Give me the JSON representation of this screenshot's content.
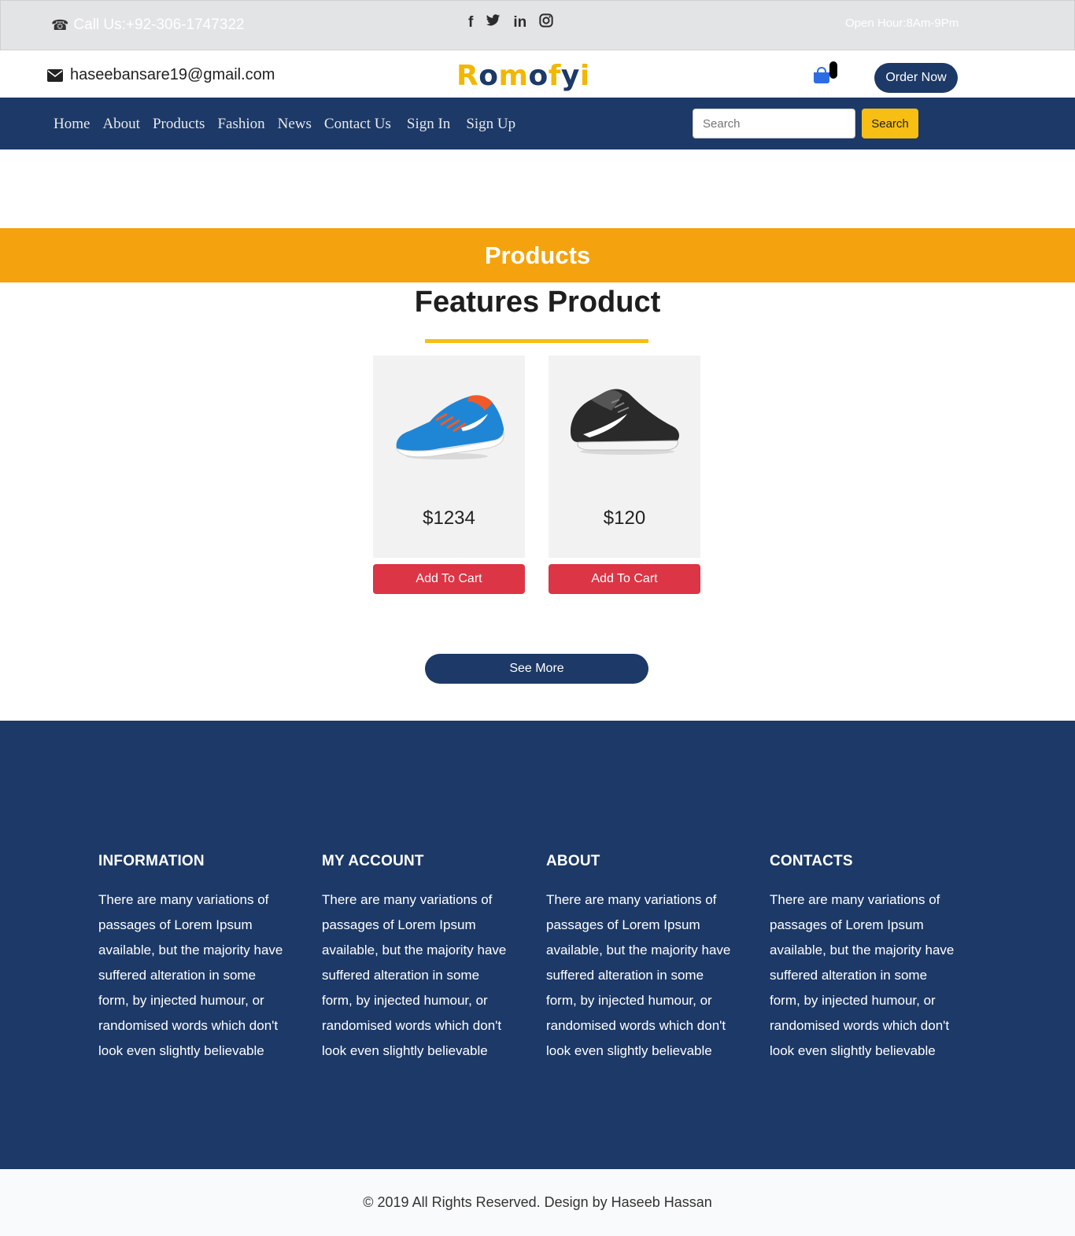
{
  "topbar": {
    "call_text": "Call Us:+92-306-1747322",
    "social_icons": [
      "facebook-icon",
      "twitter-icon",
      "linkedin-icon",
      "instagram-icon"
    ],
    "hours_text": "Open Hour:8Am-9Pm"
  },
  "header": {
    "email": "haseebansare19@gmail.com",
    "logo_parts": [
      "R",
      "o",
      "m",
      "o",
      "f",
      "y",
      "i"
    ],
    "order_label": "Order Now"
  },
  "nav": {
    "links": [
      "Home",
      "About",
      "Products",
      "Fashion",
      "News",
      "Contact Us",
      "Sign In",
      "Sign Up"
    ],
    "search_placeholder": "Search",
    "search_button": "Search"
  },
  "banner": {
    "title": "Products"
  },
  "features": {
    "title": "Features Product",
    "products": [
      {
        "price": "$1234",
        "button": "Add To Cart",
        "color": "#1f86d6"
      },
      {
        "price": "$120",
        "button": "Add To Cart",
        "color": "#2a2a2a"
      }
    ],
    "see_more": "See More"
  },
  "footer": {
    "columns": [
      {
        "title": "INFORMATION",
        "text": "There are many variations of passages of Lorem Ipsum available, but the majority have suffered alteration in some form, by injected humour, or randomised words which don't look even slightly believable"
      },
      {
        "title": "MY ACCOUNT",
        "text": "There are many variations of passages of Lorem Ipsum available, but the majority have suffered alteration in some form, by injected humour, or randomised words which don't look even slightly believable"
      },
      {
        "title": "ABOUT",
        "text": "There are many variations of passages of Lorem Ipsum available, but the majority have suffered alteration in some form, by injected humour, or randomised words which don't look even slightly believable"
      },
      {
        "title": "CONTACTS",
        "text": "There are many variations of passages of Lorem Ipsum available, but the majority have suffered alteration in some form, by injected humour, or randomised words which don't look even slightly believable"
      }
    ],
    "copyright": "© 2019 All Rights Reserved. Design by Haseeb Hassan"
  },
  "colors": {
    "navy": "#1c3967",
    "banner_orange": "#f4a30e",
    "accent_yellow": "#f7be14",
    "cart_red": "#dc3545"
  }
}
